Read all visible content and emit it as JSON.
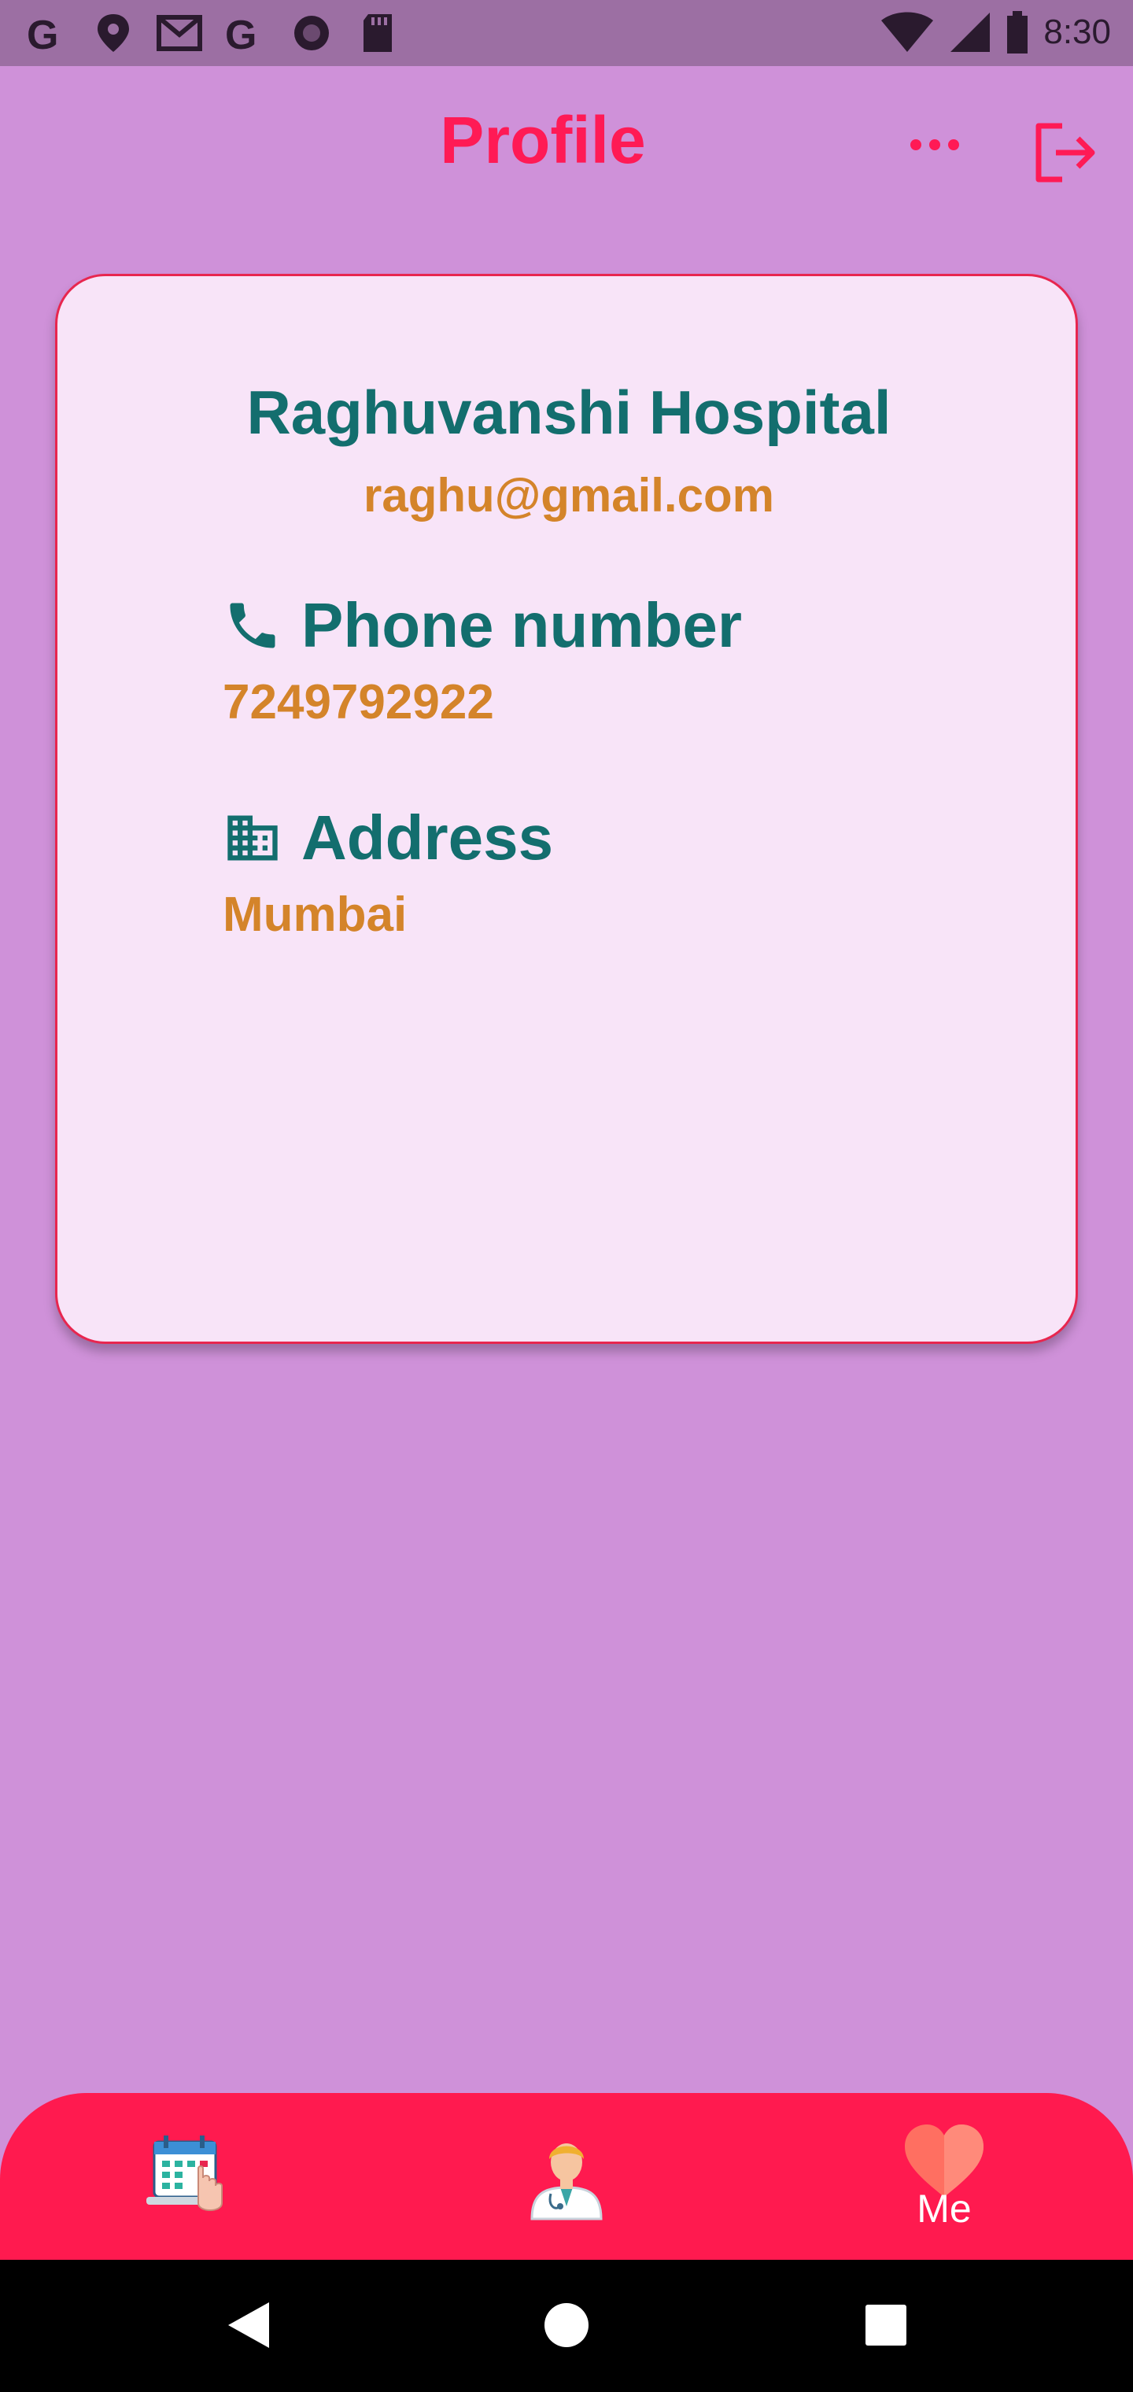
{
  "status_bar": {
    "time": "8:30",
    "icons_left": [
      "google-icon",
      "location-pin-icon",
      "gmail-icon",
      "google-icon",
      "circle-icon",
      "sd-card-icon"
    ],
    "icons_right": [
      "wifi-icon",
      "signal-icon",
      "battery-icon"
    ]
  },
  "app_bar": {
    "title": "Profile",
    "more_icon": "more-horizontal-icon",
    "logout_icon": "logout-icon",
    "accent_color": "#ff1a55"
  },
  "profile": {
    "name": "Raghuvanshi Hospital",
    "email": "raghu@gmail.com",
    "phone_label": "Phone number",
    "phone_value": "7249792922",
    "address_label": "Address",
    "address_value": "Mumbai"
  },
  "colors": {
    "background": "#cf91d9",
    "card": "#f8e4f8",
    "heading": "#136e6e",
    "value": "#d4842a",
    "nav": "#ff1a4f"
  },
  "bottom_nav": {
    "items": [
      {
        "icon": "calendar-booking-icon"
      },
      {
        "icon": "doctor-icon"
      },
      {
        "icon": "heart-icon",
        "label": "Me"
      }
    ]
  },
  "system_nav": [
    "back-icon",
    "home-icon",
    "recents-icon"
  ]
}
